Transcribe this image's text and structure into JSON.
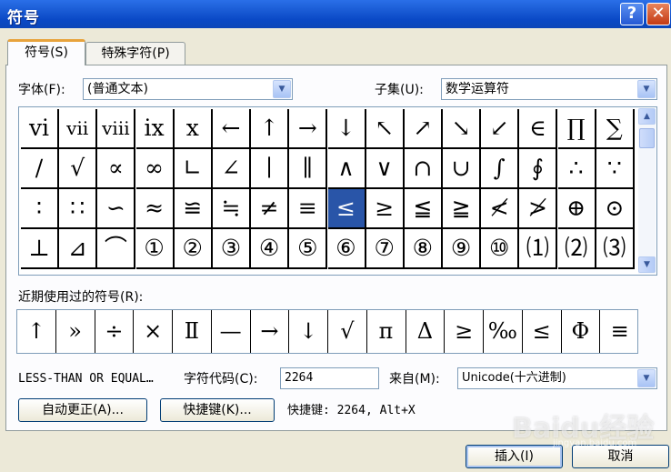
{
  "window": {
    "title": "符号"
  },
  "tabs": [
    {
      "label": "符号(S)"
    },
    {
      "label": "特殊字符(P)"
    }
  ],
  "font": {
    "label": "字体(F):",
    "value": "(普通文本)"
  },
  "subset": {
    "label": "子集(U):",
    "value": "数学运算符"
  },
  "symbols": [
    "vi",
    "vii",
    "viii",
    "ix",
    "x",
    "←",
    "↑",
    "→",
    "↓",
    "↖",
    "↗",
    "↘",
    "↙",
    "∈",
    "∏",
    "∑",
    "∕",
    "√",
    "∝",
    "∞",
    "∟",
    "∠",
    "∣",
    "∥",
    "∧",
    "∨",
    "∩",
    "∪",
    "∫",
    "∮",
    "∴",
    "∵",
    "∶",
    "∷",
    "∽",
    "≈",
    "≌",
    "≒",
    "≠",
    "≡",
    "≤",
    "≥",
    "≦",
    "≧",
    "≮",
    "≯",
    "⊕",
    "⊙",
    "⊥",
    "⊿",
    "⌒",
    "①",
    "②",
    "③",
    "④",
    "⑤",
    "⑥",
    "⑦",
    "⑧",
    "⑨",
    "⑩",
    "⑴",
    "⑵",
    "⑶"
  ],
  "selected_symbol": "≤",
  "recent": {
    "label": "近期使用过的符号(R):",
    "symbols": [
      "↑",
      "»",
      "÷",
      "×",
      "Ⅱ",
      "—",
      "→",
      "↓",
      "√",
      "п",
      "Δ",
      "≥",
      "‰",
      "≤",
      "Φ",
      "≡"
    ]
  },
  "char_name": "LESS-THAN OR EQUAL…",
  "char_code": {
    "label": "字符代码(C):",
    "value": "2264"
  },
  "from": {
    "label": "来自(M):",
    "value": "Unicode(十六进制)"
  },
  "buttons": {
    "autocorrect": "自动更正(A)...",
    "shortcut_key": "快捷键(K)...",
    "insert": "插入(I)",
    "cancel": "取消"
  },
  "shortcut_text": "快捷键: 2264, Alt+X",
  "watermark": {
    "text": "Baidu经验",
    "sub": "jingyan.baidu.com"
  }
}
